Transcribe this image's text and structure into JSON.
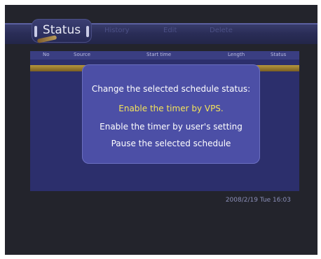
{
  "menu": {
    "status_label": "Status",
    "tabs": [
      "History",
      "Edit",
      "Delete"
    ]
  },
  "table": {
    "headers": [
      "No",
      "Source",
      "Start time",
      "Length",
      "Status"
    ]
  },
  "dialog": {
    "prompt": "Change the selected schedule status:",
    "options": [
      "Enable the timer by VPS.",
      "Enable the timer by user's setting",
      "Pause the selected schedule"
    ],
    "selected_index": 0
  },
  "status_bar": {
    "datetime": "2008/2/19 Tue 16:03"
  },
  "colors": {
    "selected_option": "#f3e35a",
    "dialog_bg": "#4c4fa6",
    "panel_bg": "#2c2f6c"
  }
}
